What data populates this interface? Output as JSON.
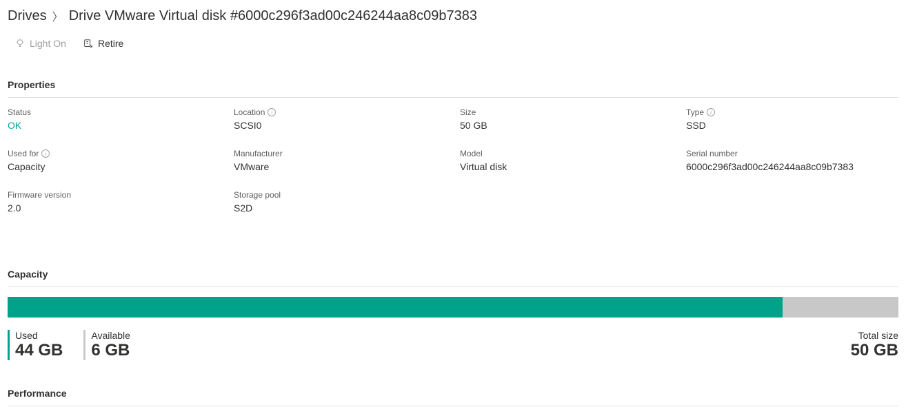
{
  "breadcrumb": {
    "parent": "Drives",
    "current": "Drive VMware Virtual disk #6000c296f3ad00c246244aa8c09b7383"
  },
  "toolbar": {
    "light_on": "Light On",
    "retire": "Retire"
  },
  "sections": {
    "properties": "Properties",
    "capacity": "Capacity",
    "performance": "Performance"
  },
  "properties": {
    "status": {
      "label": "Status",
      "value": "OK"
    },
    "location": {
      "label": "Location",
      "value": "SCSI0"
    },
    "size": {
      "label": "Size",
      "value": "50 GB"
    },
    "type": {
      "label": "Type",
      "value": "SSD"
    },
    "used_for": {
      "label": "Used for",
      "value": "Capacity"
    },
    "manufacturer": {
      "label": "Manufacturer",
      "value": "VMware"
    },
    "model": {
      "label": "Model",
      "value": "Virtual disk"
    },
    "serial_number": {
      "label": "Serial number",
      "value": "6000c296f3ad00c246244aa8c09b7383"
    },
    "firmware_version": {
      "label": "Firmware version",
      "value": "2.0"
    },
    "storage_pool": {
      "label": "Storage pool",
      "value": "S2D"
    }
  },
  "capacity": {
    "used_label": "Used",
    "used_value": "44 GB",
    "available_label": "Available",
    "available_value": "6 GB",
    "total_label": "Total size",
    "total_value": "50 GB",
    "used_percent": 87
  },
  "chart_data": {
    "type": "bar",
    "title": "Capacity",
    "categories": [
      "Used",
      "Available"
    ],
    "values": [
      44,
      6
    ],
    "unit": "GB",
    "total": 50,
    "colors": {
      "used": "#00a389",
      "available": "#c8c8c8"
    }
  }
}
